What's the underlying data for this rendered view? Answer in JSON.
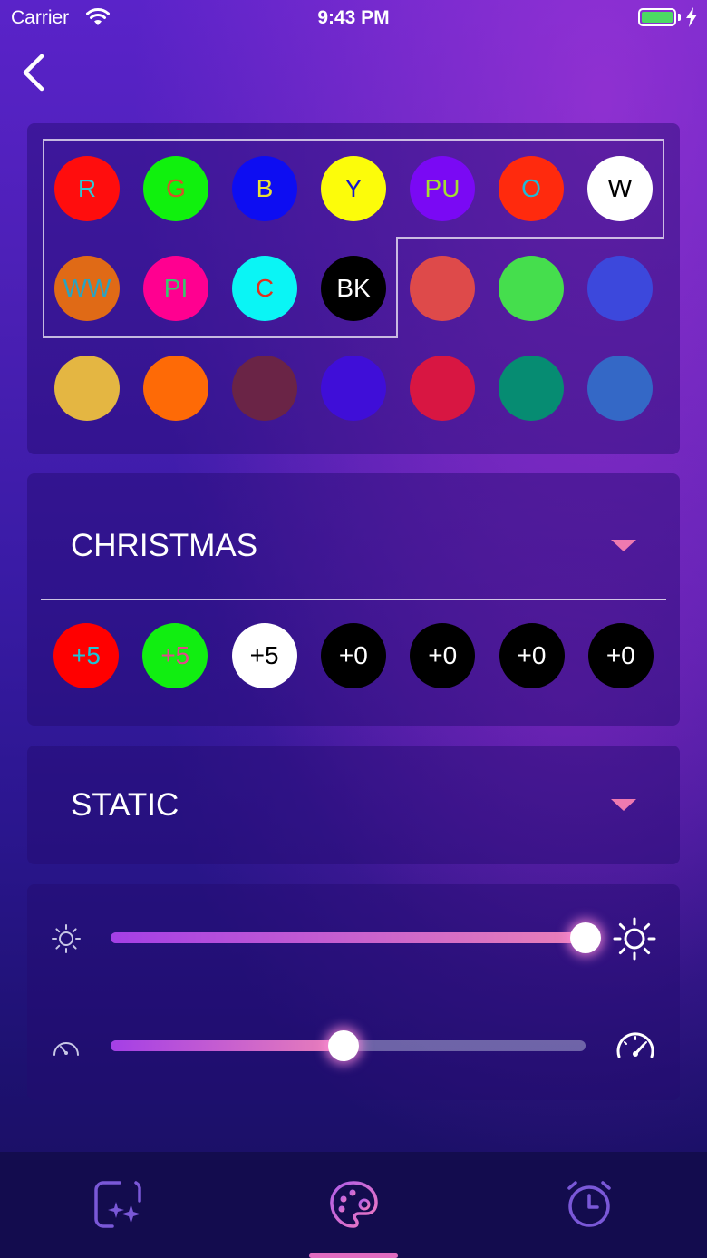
{
  "status_bar": {
    "carrier": "Carrier",
    "time": "9:43 PM"
  },
  "nav": {
    "back_icon": "chevron-left-icon"
  },
  "colors": {
    "row1": [
      {
        "label": "R",
        "bg": "#ff0d0d",
        "fg": "#2ec9d4"
      },
      {
        "label": "G",
        "bg": "#10f10d",
        "fg": "#d6502a"
      },
      {
        "label": "B",
        "bg": "#0d0df2",
        "fg": "#e8e034"
      },
      {
        "label": "Y",
        "bg": "#fcfc0a",
        "fg": "#1717cc"
      },
      {
        "label": "PU",
        "bg": "#7a09f4",
        "fg": "#a4de30"
      },
      {
        "label": "O",
        "bg": "#ff2a0d",
        "fg": "#1fb9d6"
      },
      {
        "label": "W",
        "bg": "#ffffff",
        "fg": "#000000"
      }
    ],
    "row2": [
      {
        "label": "WW",
        "bg": "#e06a16",
        "fg": "#2aa3c0"
      },
      {
        "label": "PI",
        "bg": "#ff0090",
        "fg": "#37c86e"
      },
      {
        "label": "C",
        "bg": "#0af5f5",
        "fg": "#e0301e"
      },
      {
        "label": "BK",
        "bg": "#000000",
        "fg": "#ffffff"
      },
      {
        "label": "",
        "bg": "#de4a4a",
        "fg": "#ffffff"
      },
      {
        "label": "",
        "bg": "#45de4d",
        "fg": "#ffffff"
      },
      {
        "label": "",
        "bg": "#3c48dc",
        "fg": "#ffffff"
      }
    ],
    "row3": [
      {
        "label": "",
        "bg": "#e4b642",
        "fg": "#ffffff"
      },
      {
        "label": "",
        "bg": "#fe6a06",
        "fg": "#ffffff"
      },
      {
        "label": "",
        "bg": "#6a2446",
        "fg": "#ffffff"
      },
      {
        "label": "",
        "bg": "#3f0ed8",
        "fg": "#ffffff"
      },
      {
        "label": "",
        "bg": "#d81642",
        "fg": "#ffffff"
      },
      {
        "label": "",
        "bg": "#068c72",
        "fg": "#ffffff"
      },
      {
        "label": "",
        "bg": "#3468c6",
        "fg": "#ffffff"
      }
    ]
  },
  "scene": {
    "selected": "CHRISTMAS",
    "dots": [
      {
        "label": "+5",
        "bg": "#ff0000",
        "fg": "#1cc6d6"
      },
      {
        "label": "+5",
        "bg": "#11ee11",
        "fg": "#e04a8a"
      },
      {
        "label": "+5",
        "bg": "#ffffff",
        "fg": "#000000"
      },
      {
        "label": "+0",
        "bg": "#000000",
        "fg": "#ffffff"
      },
      {
        "label": "+0",
        "bg": "#000000",
        "fg": "#ffffff"
      },
      {
        "label": "+0",
        "bg": "#000000",
        "fg": "#ffffff"
      },
      {
        "label": "+0",
        "bg": "#000000",
        "fg": "#ffffff"
      }
    ]
  },
  "mode": {
    "selected": "STATIC"
  },
  "sliders": {
    "brightness": {
      "value_fraction": 1.0,
      "min_icon": "sun-small-icon",
      "max_icon": "sun-large-icon"
    },
    "speed": {
      "value_fraction": 0.49,
      "min_icon": "speedometer-slow-icon",
      "max_icon": "speedometer-fast-icon"
    }
  },
  "tabs": [
    {
      "icon": "magic-scene-icon",
      "active": false
    },
    {
      "icon": "palette-icon",
      "active": true
    },
    {
      "icon": "alarm-clock-icon",
      "active": false
    }
  ],
  "accent_color": "#e06cc0"
}
